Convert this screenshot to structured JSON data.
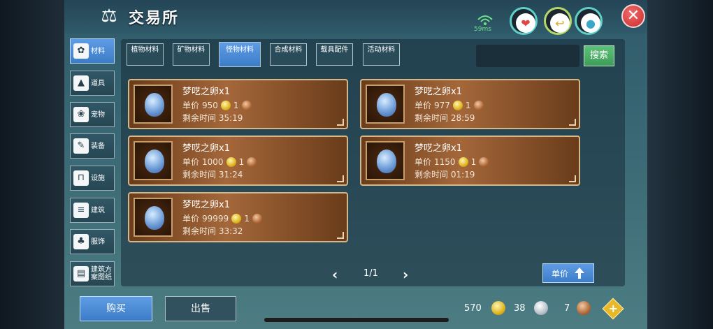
{
  "header": {
    "title": "交易所",
    "ping": "59ms",
    "close_symbol": "✕"
  },
  "sidebar": {
    "items": [
      {
        "label": "材料",
        "icon": "material-icon",
        "glyph": "✿"
      },
      {
        "label": "道具",
        "icon": "item-icon",
        "glyph": "▲"
      },
      {
        "label": "宠物",
        "icon": "pet-paw-icon",
        "glyph": "❀"
      },
      {
        "label": "装备",
        "icon": "equipment-icon",
        "glyph": "✎"
      },
      {
        "label": "设施",
        "icon": "facility-icon",
        "glyph": "⊓"
      },
      {
        "label": "建筑",
        "icon": "building-icon",
        "glyph": "≡"
      },
      {
        "label": "服饰",
        "icon": "clothing-icon",
        "glyph": "♣"
      },
      {
        "label": "建筑方案图纸",
        "icon": "blueprint-icon",
        "glyph": "▤"
      }
    ]
  },
  "tabs": [
    "植物材料",
    "矿物材料",
    "怪物材料",
    "合成材料",
    "载具配件",
    "活动材料"
  ],
  "active_tab": 2,
  "search": {
    "button_label": "搜索"
  },
  "listings": [
    {
      "name": "梦呓之卵x1",
      "price_label": "单价",
      "price": "950",
      "qty": "1",
      "time_label": "剩余时间",
      "time": "35:19"
    },
    {
      "name": "梦呓之卵x1",
      "price_label": "单价",
      "price": "977",
      "qty": "1",
      "time_label": "剩余时间",
      "time": "28:59"
    },
    {
      "name": "梦呓之卵x1",
      "price_label": "单价",
      "price": "1000",
      "qty": "1",
      "time_label": "剩余时间",
      "time": "31:24"
    },
    {
      "name": "梦呓之卵x1",
      "price_label": "单价",
      "price": "1150",
      "qty": "1",
      "time_label": "剩余时间",
      "time": "01:19"
    },
    {
      "name": "梦呓之卵x1",
      "price_label": "单价",
      "price": "99999",
      "qty": "1",
      "time_label": "剩余时间",
      "time": "33:32"
    }
  ],
  "pager": {
    "text": "1/1",
    "prev": "‹",
    "next": "›"
  },
  "sort": {
    "label": "单价"
  },
  "footer": {
    "buy_label": "购买",
    "sell_label": "出售",
    "gold": "570",
    "silver": "38",
    "copper": "7",
    "plus": "+"
  },
  "colors": {
    "accent_blue": "#4f8fdc",
    "card_brown": "#a4673a",
    "close_red": "#d83a3a",
    "search_green": "#4fae68"
  }
}
